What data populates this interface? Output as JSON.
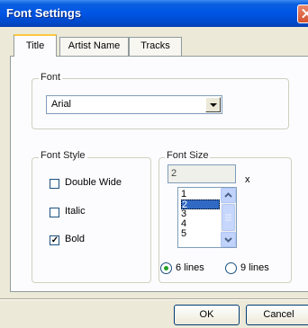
{
  "window": {
    "title": "Font Settings",
    "close_icon": "close-icon"
  },
  "tabs": [
    {
      "label": "Title",
      "active": true
    },
    {
      "label": "Artist Name",
      "active": false
    },
    {
      "label": "Tracks",
      "active": false
    }
  ],
  "font_group": {
    "legend": "Font",
    "selected_font": "Arial"
  },
  "font_style": {
    "legend": "Font Style",
    "options": [
      {
        "label": "Double Wide",
        "checked": false
      },
      {
        "label": "Italic",
        "checked": false
      },
      {
        "label": "Bold",
        "checked": true
      }
    ]
  },
  "font_size": {
    "legend": "Font Size",
    "value": "2",
    "suffix": "x",
    "list": [
      "1",
      "2",
      "3",
      "4",
      "5"
    ],
    "selected": "2",
    "lines_options": [
      {
        "label": "6 lines",
        "selected": true
      },
      {
        "label": "9 lines",
        "selected": false
      }
    ]
  },
  "buttons": {
    "ok": "OK",
    "cancel": "Cancel"
  },
  "colors": {
    "titlebar": "#0055e5",
    "selection": "#316ac5",
    "tab_highlight": "#ffc83c"
  }
}
